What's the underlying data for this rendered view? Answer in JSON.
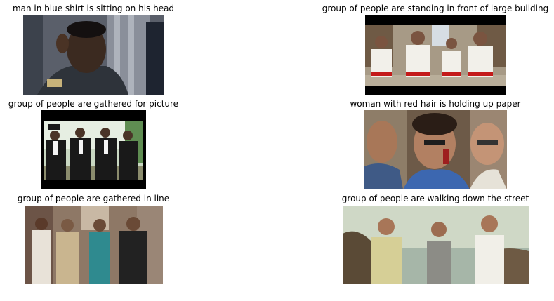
{
  "grid": {
    "items": [
      {
        "caption": "man in blue shirt is sitting on his head",
        "image": "man-pointing-to-head-photo"
      },
      {
        "caption": "group of people are standing in front of large building",
        "image": "men-dancing-in-street-photo"
      },
      {
        "caption": "group of people are gathered for picture",
        "image": "pallbearers-in-suits-photo"
      },
      {
        "caption": "woman with red hair is holding up paper",
        "image": "men-talking-on-phone-photo"
      },
      {
        "caption": "group of people are gathered in line",
        "image": "group-walking-in-alley-photo"
      },
      {
        "caption": "group of people are walking down the street",
        "image": "men-walking-by-sea-photo"
      }
    ]
  }
}
